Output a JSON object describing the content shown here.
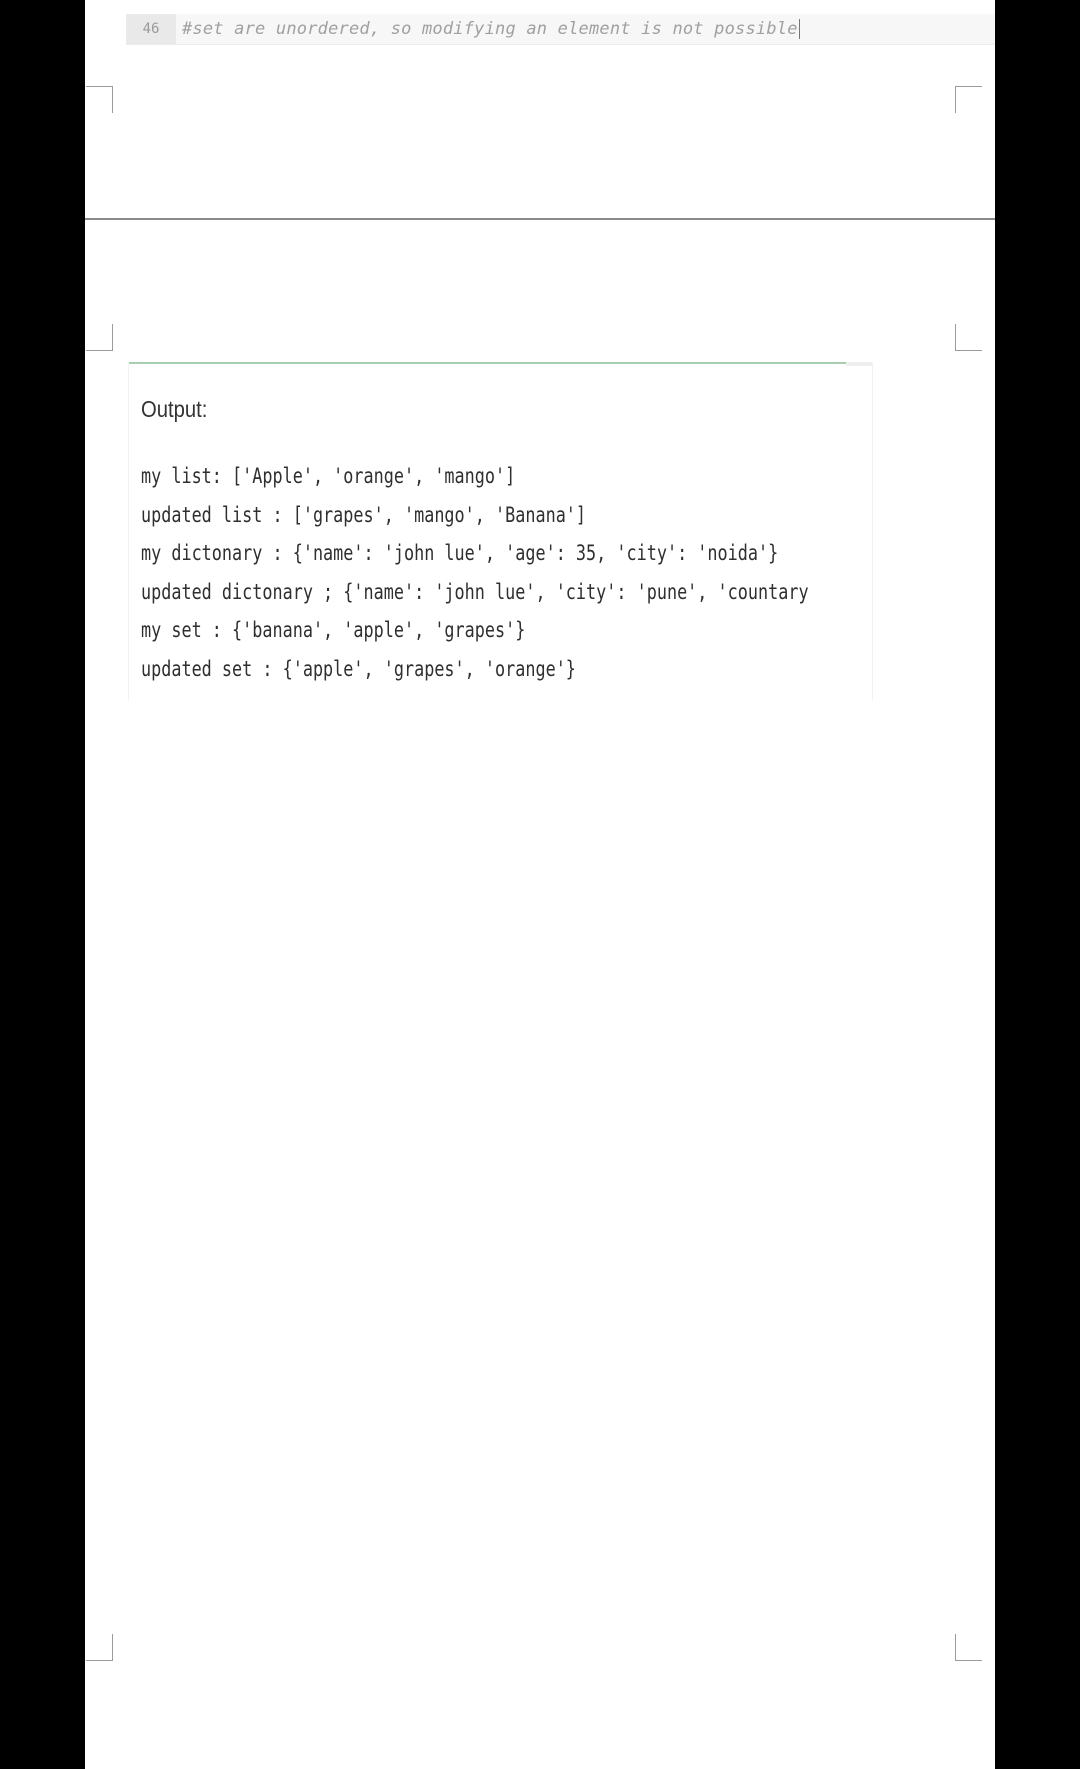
{
  "editor": {
    "line_number": "46",
    "code_comment": "#set are unordered, so modifying an element is not possible"
  },
  "output": {
    "heading": "Output:",
    "lines": [
      "my list: ['Apple', 'orange', 'mango']",
      "updated list : ['grapes', 'mango', 'Banana']",
      "my dictonary : {'name': 'john lue', 'age': 35, 'city': 'noida'}",
      "updated dictonary ; {'name': 'john lue', 'city': 'pune', 'countary",
      "my set : {'banana', 'apple', 'grapes'}",
      "updated set : {'apple', 'grapes', 'orange'}"
    ]
  },
  "colors": {
    "background": "#000000",
    "page": "#ffffff",
    "rule_accent": "#a9cfb1",
    "comment_text": "#a0a0a0"
  }
}
